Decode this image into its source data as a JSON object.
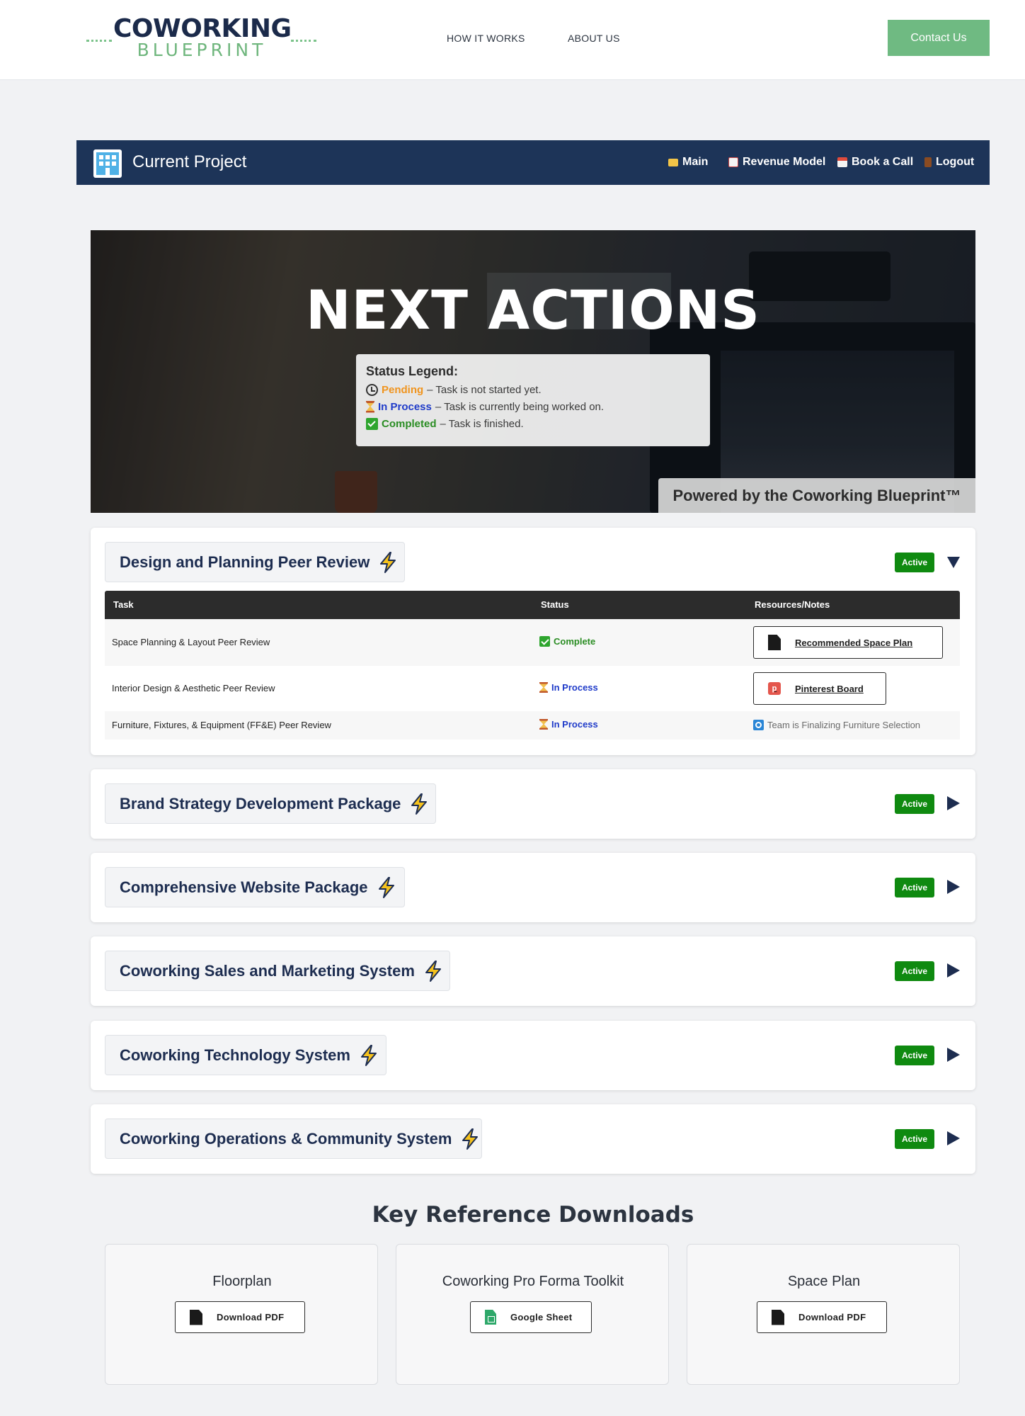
{
  "site_header": {
    "logo_main": "COWORKING",
    "logo_sub": "BLUEPRINT",
    "nav": [
      "HOW IT WORKS",
      "ABOUT US"
    ],
    "contact_label": "Contact Us"
  },
  "project_bar": {
    "title": "Current Project",
    "nav": [
      {
        "label": "Main",
        "icon": "folder-icon"
      },
      {
        "label": "Revenue Model",
        "icon": "chart-icon"
      },
      {
        "label": "Book a Call",
        "icon": "calendar-icon"
      },
      {
        "label": "Logout",
        "icon": "door-icon"
      }
    ]
  },
  "hero": {
    "title": "NEXT ACTIONS",
    "legend": {
      "title": "Status Legend:",
      "rows": [
        {
          "icon": "clock-icon",
          "status": "Pending",
          "desc": " – Task is not started yet."
        },
        {
          "icon": "hourglass-icon",
          "status": "In Process",
          "desc": " – Task is currently being worked on."
        },
        {
          "icon": "check-icon",
          "status": "Completed",
          "desc": " – Task is finished."
        }
      ]
    },
    "powered": "Powered by the Coworking Blueprint™"
  },
  "sections": [
    {
      "title": "Design and Planning Peer Review",
      "badge": "Active",
      "expanded": true,
      "table": {
        "headers": [
          "Task",
          "Status",
          "Resources/Notes"
        ],
        "rows": [
          {
            "task": "Space Planning & Layout Peer Review",
            "status": "Complete",
            "resource": "Recommended Space Plan"
          },
          {
            "task": "Interior Design & Aesthetic Peer Review",
            "status": "In Process",
            "resource": "Pinterest Board"
          },
          {
            "task": "Furniture, Fixtures, & Equipment (FF&E) Peer Review",
            "status": "In Process",
            "note": "Team is Finalizing Furniture Selection"
          }
        ]
      }
    },
    {
      "title": "Brand Strategy Development Package",
      "badge": "Active",
      "expanded": false
    },
    {
      "title": "Comprehensive Website Package",
      "badge": "Active",
      "expanded": false
    },
    {
      "title": "Coworking Sales and Marketing System",
      "badge": "Active",
      "expanded": false
    },
    {
      "title": "Coworking Technology System",
      "badge": "Active",
      "expanded": false
    },
    {
      "title": "Coworking Operations & Community System",
      "badge": "Active",
      "expanded": false
    }
  ],
  "downloads": {
    "title": "Key Reference Downloads",
    "items": [
      {
        "name": "Floorplan",
        "button": "Download PDF",
        "icon": "pdf-icon"
      },
      {
        "name": "Coworking Pro Forma Toolkit",
        "button": "Google Sheet",
        "icon": "sheet-icon"
      },
      {
        "name": "Space Plan",
        "button": "Download PDF",
        "icon": "pdf-icon"
      }
    ]
  },
  "colors": {
    "navy": "#1d3458",
    "brand_green": "#6fba82",
    "active_badge": "#0f8a10",
    "pending": "#f0941e",
    "in_process": "#1f3bc9",
    "completed": "#2a8d23"
  }
}
